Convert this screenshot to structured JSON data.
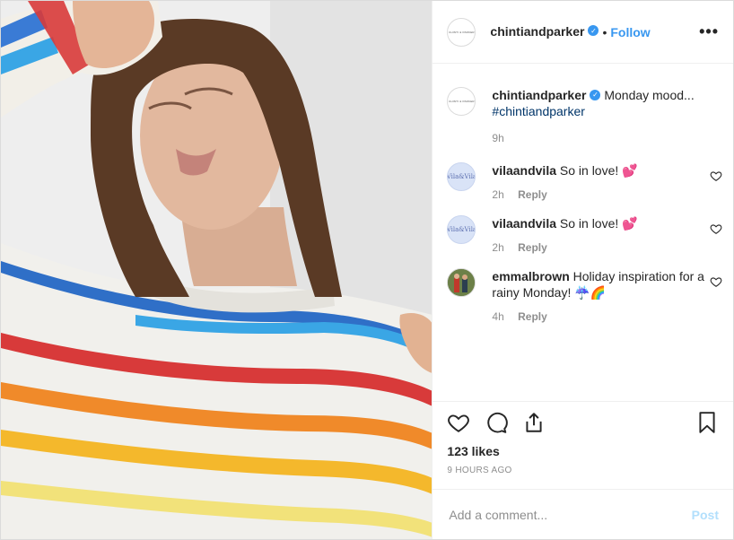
{
  "header": {
    "avatar_text": "CHINTI & PARKER",
    "username": "chintiandparker",
    "separator": "•",
    "follow_label": "Follow",
    "more_label": "•••"
  },
  "caption": {
    "avatar_text": "CHINTI & PARKER",
    "username": "chintiandparker",
    "text": "Monday mood...",
    "hashtag": "#chintiandparker",
    "time": "9h"
  },
  "comments": [
    {
      "avatar_text": "Vila&Vila",
      "username": "vilaandvila",
      "text": "So in love! ",
      "emoji": "💕",
      "time": "2h",
      "reply_label": "Reply"
    },
    {
      "avatar_text": "Vila&Vila",
      "username": "vilaandvila",
      "text": "So in love! ",
      "emoji": "💕",
      "time": "2h",
      "reply_label": "Reply"
    },
    {
      "username": "emmalbrown",
      "text": "Holiday inspiration for a rainy Monday! ",
      "emoji": "☔🌈",
      "time": "4h",
      "reply_label": "Reply"
    }
  ],
  "likes": "123 likes",
  "posted": "9 HOURS AGO",
  "add_comment": {
    "placeholder": "Add a comment...",
    "post_label": "Post"
  },
  "colors": {
    "accent": "#3897f0",
    "text": "#262626",
    "muted": "#8e8e8e",
    "post_disabled": "#b2dffc"
  }
}
